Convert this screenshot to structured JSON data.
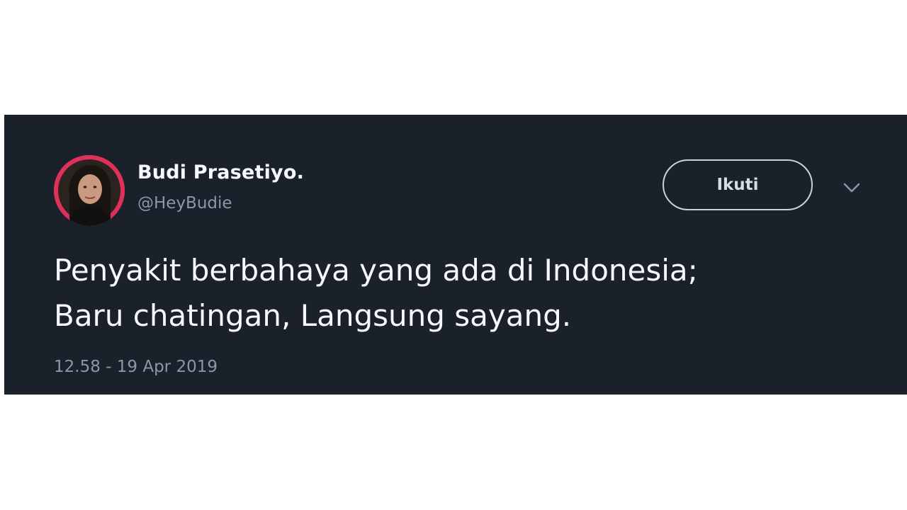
{
  "tweet": {
    "author": {
      "display_name": "Budi Prasetiyo.",
      "handle": "@HeyBudie",
      "avatar_icon": "profile-photo"
    },
    "follow_label": "Ikuti",
    "more_icon": "chevron-down-icon",
    "text_lines": [
      "Penyakit berbahaya yang ada di Indonesia;",
      "Baru chatingan, Langsung sayang."
    ],
    "timestamp": "12.58 - 19 Apr 2019"
  },
  "colors": {
    "page_background": "#ffffff",
    "card_background": "#1a212b",
    "primary_text": "#f5f8fa",
    "secondary_text": "#8899a6",
    "avatar_ring": "#e0305a"
  }
}
